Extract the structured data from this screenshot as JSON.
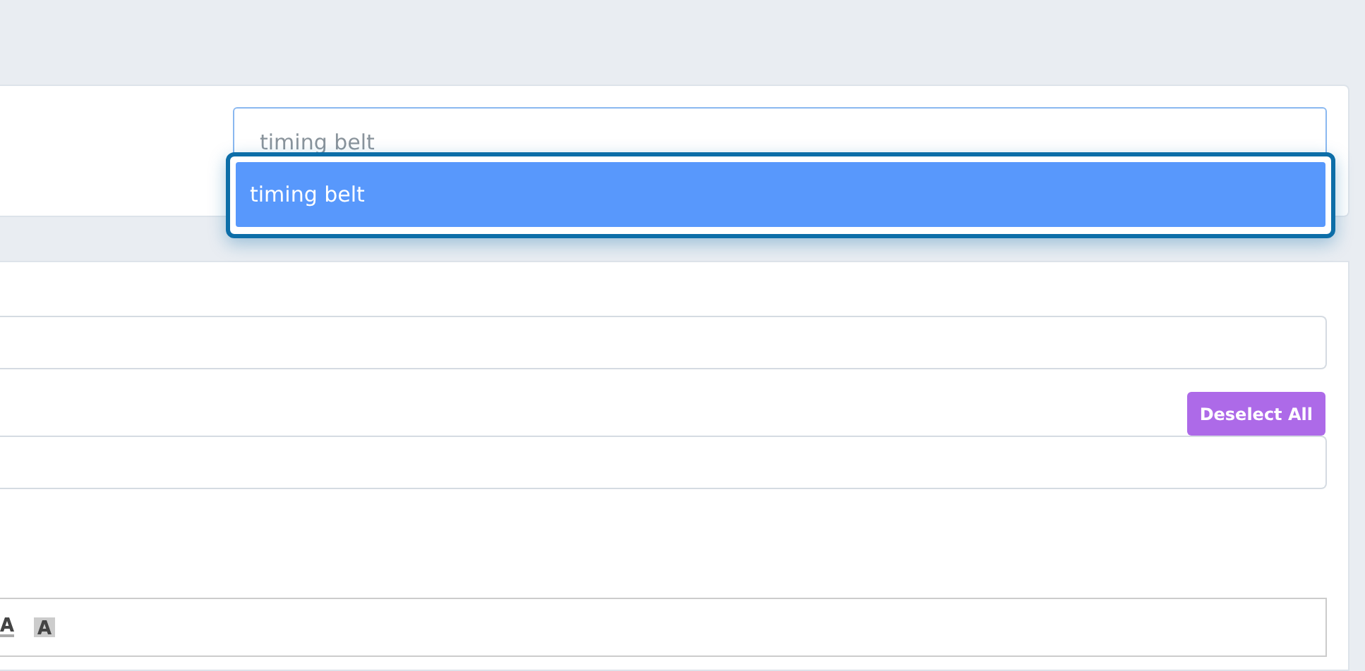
{
  "search": {
    "value": "timing belt"
  },
  "suggestions": [
    {
      "label": "timing belt",
      "selected": true
    }
  ],
  "form": {
    "deselect_button": "Deselect All"
  }
}
